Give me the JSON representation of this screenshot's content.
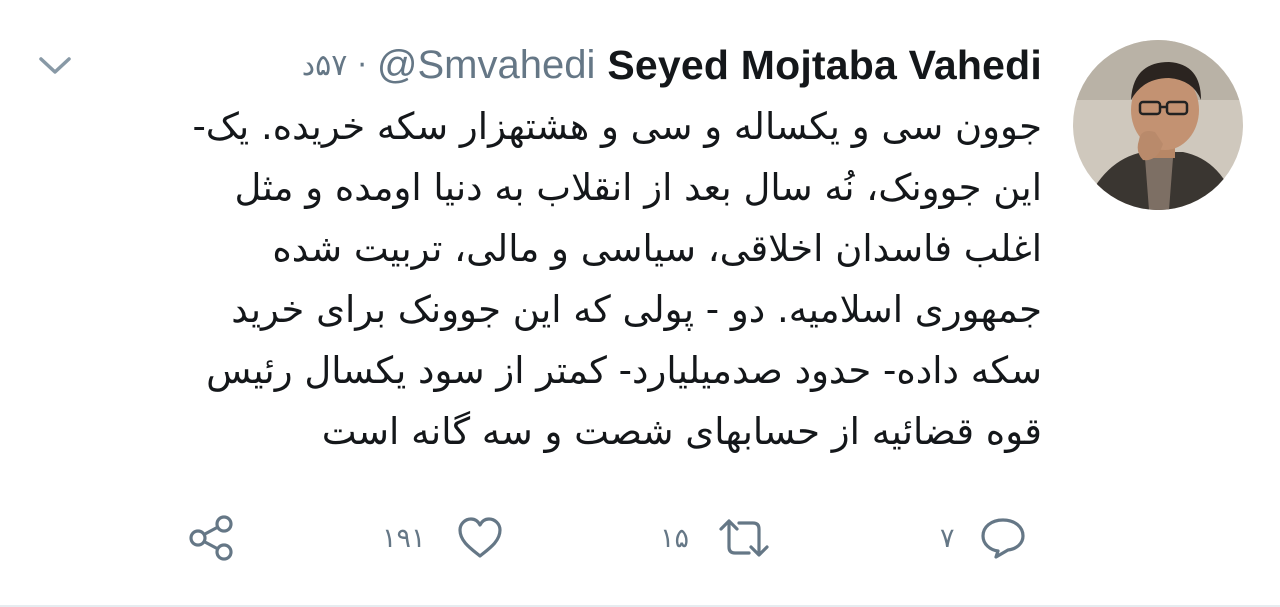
{
  "tweet": {
    "display_name": "Seyed Mojtaba Vahedi",
    "handle": "@Smvahedi",
    "separator": "·",
    "time": "۵۷د",
    "body_lines": [
      "جوون سی و یکساله و سی و هشتهزار سکه خریده. یک-",
      "این جوونک، نُه سال بعد از انقلاب به دنیا اومده و مثل",
      "اغلب فاسدان اخلاقی، سیاسی و مالی، تربیت شده",
      "جمهوری اسلامیه. دو - پولی که این جوونک برای خرید",
      "سکه داده- حدود صدمیلیارد- کمتر از سود یکسال رئیس",
      "قوه قضائیه از حسابهای شصت و سه گانه است"
    ]
  },
  "actions": {
    "reply_count": "۷",
    "retweet_count": "۱۵",
    "like_count": "۱۹۱"
  },
  "icons": {
    "reply": "reply-icon",
    "retweet": "retweet-icon",
    "like": "heart-icon",
    "share": "share-icon",
    "caret": "chevron-down-icon"
  },
  "colors": {
    "text": "#14171a",
    "secondary": "#657786",
    "icon": "#657786",
    "divider": "#e6ecf0"
  }
}
